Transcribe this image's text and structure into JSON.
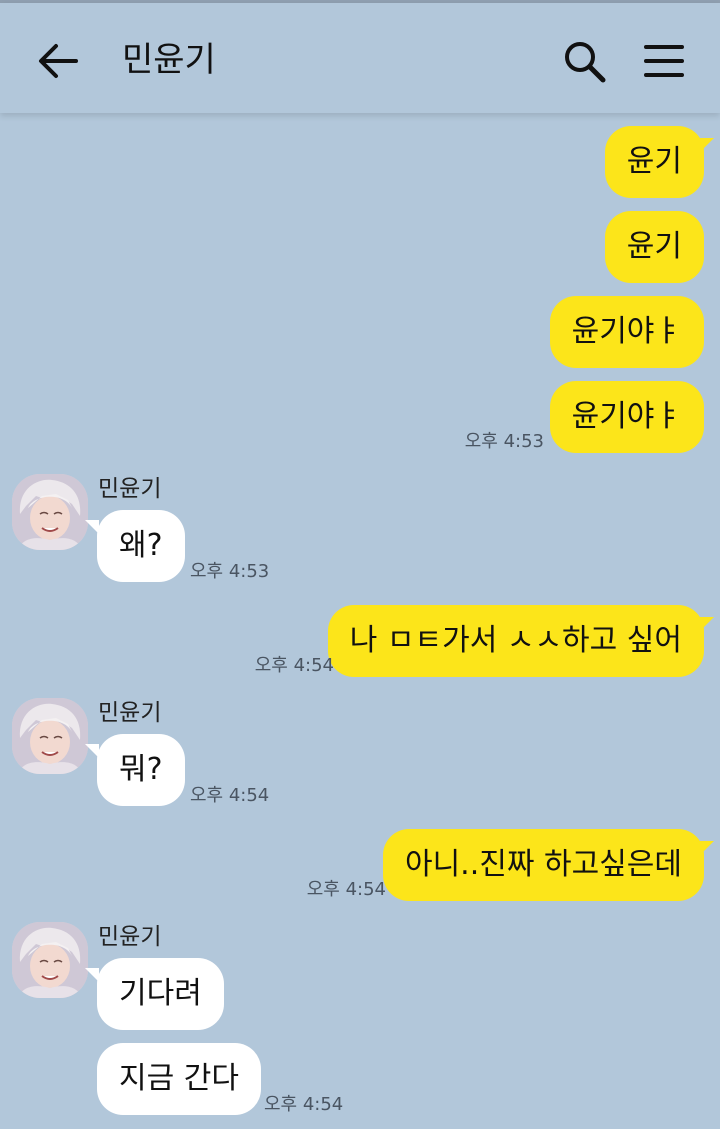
{
  "header": {
    "title": "민윤기"
  },
  "icons": {
    "back": "arrow-left-icon",
    "search": "search-icon",
    "menu": "hamburger-menu-icon"
  },
  "colors": {
    "background": "#b2c7da",
    "my_bubble": "#fce51a",
    "their_bubble": "#ffffff"
  },
  "messages": [
    {
      "text": "윤기",
      "from": "me"
    },
    {
      "text": "윤기",
      "from": "me"
    },
    {
      "text": "윤기야ㅑ",
      "from": "me"
    },
    {
      "text": "윤기야ㅑ",
      "from": "me",
      "time": "오후 4:53"
    },
    {
      "sender": "민윤기",
      "text": "왜?",
      "from": "other",
      "time": "오후 4:53"
    },
    {
      "text": "나 ㅁㅌ가서 ㅅㅅ하고 싶어",
      "from": "me",
      "time": "오후 4:54"
    },
    {
      "sender": "민윤기",
      "text": "뭐?",
      "from": "other",
      "time": "오후 4:54"
    },
    {
      "text": "아니..진짜 하고싶은데",
      "from": "me",
      "time": "오후 4:54"
    },
    {
      "sender": "민윤기",
      "text": "기다려",
      "from": "other"
    },
    {
      "text": "지금 간다",
      "from": "other",
      "time": "오후 4:54"
    }
  ]
}
